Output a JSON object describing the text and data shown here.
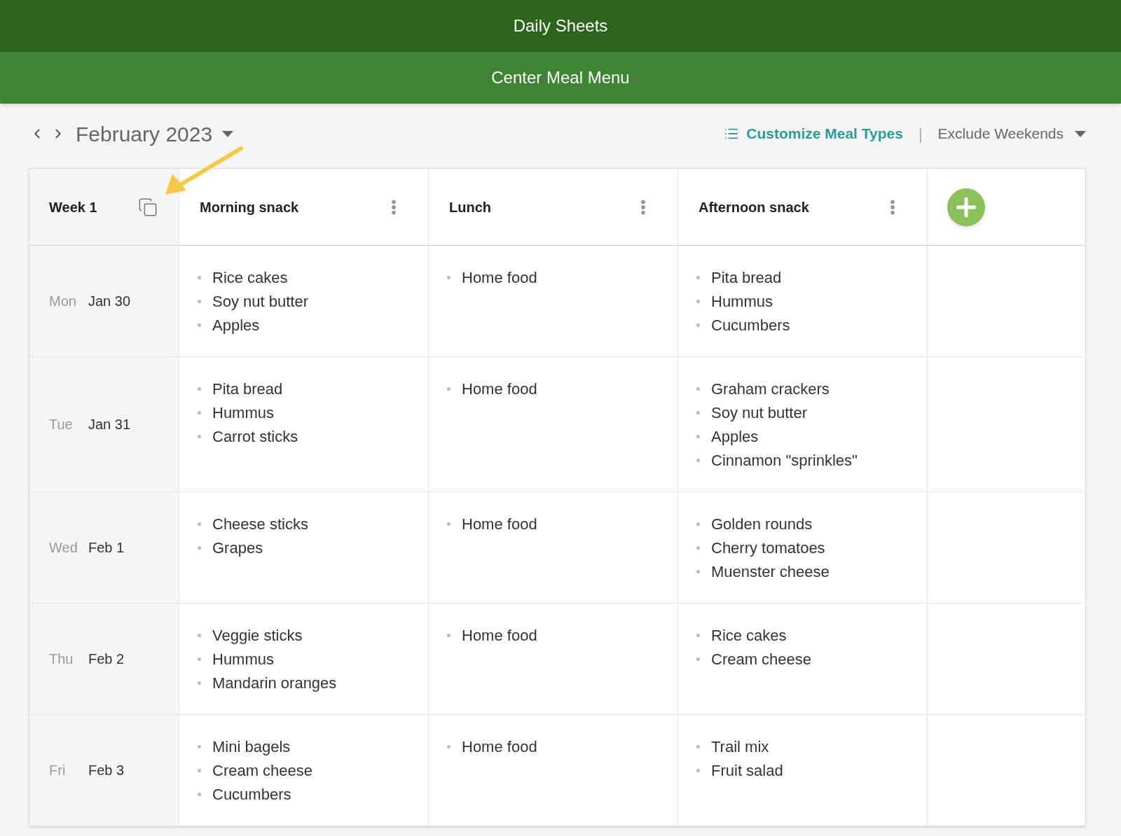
{
  "app_bar": {
    "title": "Daily Sheets"
  },
  "sub_bar": {
    "title": "Center Meal Menu"
  },
  "toolbar": {
    "month": "February 2023",
    "customize_link": "Customize Meal Types",
    "separator": "|",
    "filter": "Exclude Weekends"
  },
  "table": {
    "week_label": "Week 1",
    "columns": [
      "Morning snack",
      "Lunch",
      "Afternoon snack"
    ],
    "rows": [
      {
        "day": "Mon",
        "date": "Jan 30",
        "meals": [
          [
            "Rice cakes",
            "Soy nut butter",
            "Apples"
          ],
          [
            "Home food"
          ],
          [
            "Pita bread",
            "Hummus",
            "Cucumbers"
          ]
        ]
      },
      {
        "day": "Tue",
        "date": "Jan 31",
        "meals": [
          [
            "Pita bread",
            "Hummus",
            "Carrot sticks"
          ],
          [
            "Home food"
          ],
          [
            "Graham crackers",
            "Soy nut butter",
            "Apples",
            "Cinnamon \"sprinkles\""
          ]
        ]
      },
      {
        "day": "Wed",
        "date": "Feb 1",
        "meals": [
          [
            "Cheese sticks",
            "Grapes"
          ],
          [
            "Home food"
          ],
          [
            "Golden rounds",
            "Cherry tomatoes",
            "Muenster cheese"
          ]
        ]
      },
      {
        "day": "Thu",
        "date": "Feb 2",
        "meals": [
          [
            "Veggie sticks",
            "Hummus",
            "Mandarin oranges"
          ],
          [
            "Home food"
          ],
          [
            "Rice cakes",
            "Cream cheese"
          ]
        ]
      },
      {
        "day": "Fri",
        "date": "Feb 3",
        "meals": [
          [
            "Mini bagels",
            "Cream cheese",
            "Cucumbers"
          ],
          [
            "Home food"
          ],
          [
            "Trail mix",
            "Fruit salad"
          ]
        ]
      }
    ]
  }
}
